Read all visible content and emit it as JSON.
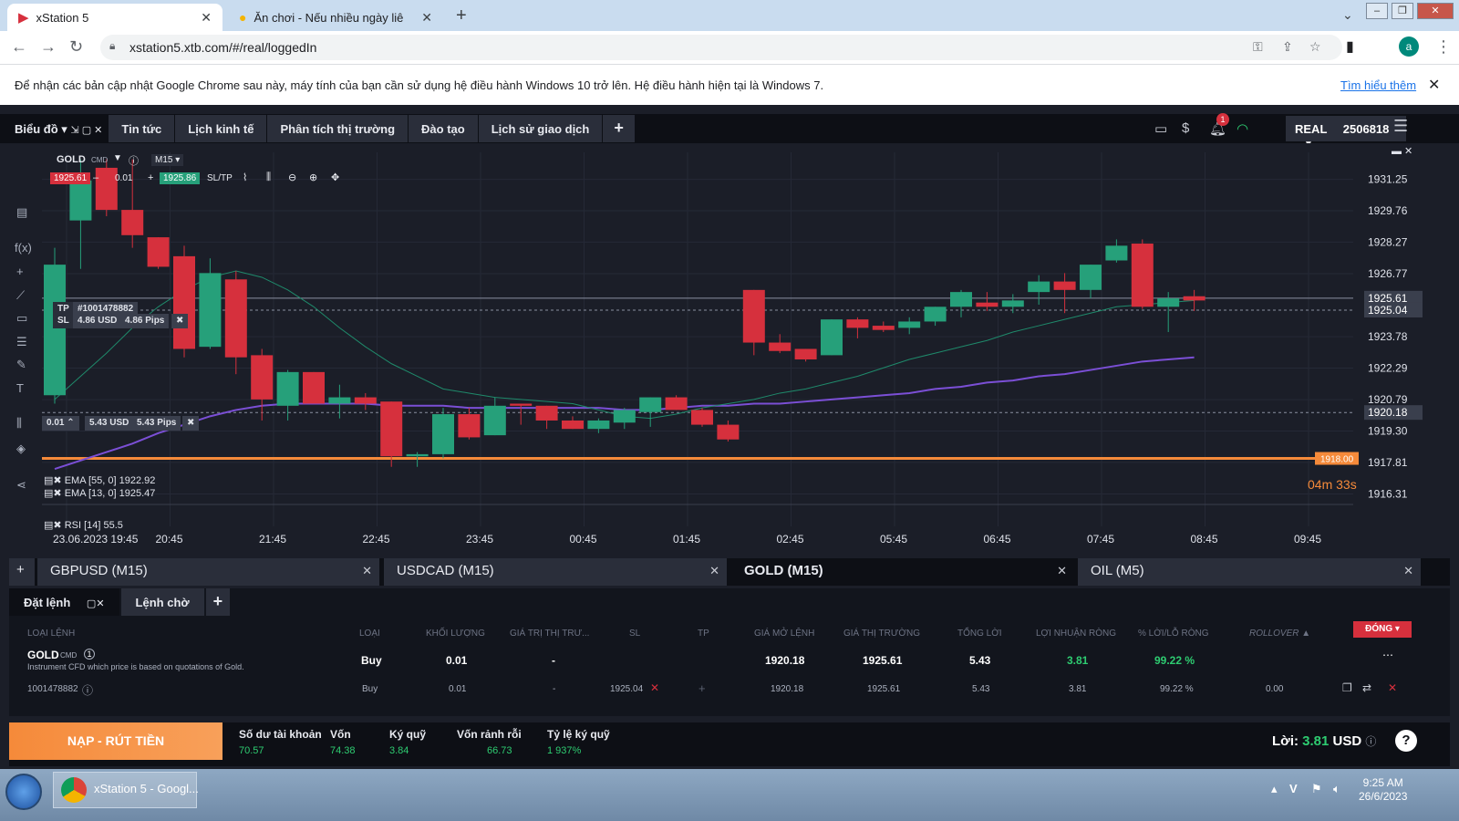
{
  "browser": {
    "tabs": [
      {
        "title": "xStation 5"
      },
      {
        "title": "Ăn chơi - Nếu nhiều ngày liên ch"
      }
    ],
    "url": "xstation5.xtb.com/#/real/loggedIn",
    "avatar_letter": "a",
    "infobar": {
      "text": "Để nhận các bản cập nhật Google Chrome sau này, máy tính của bạn cần sử dụng hệ điều hành Windows 10 trở lên. Hệ điều hành hiện tại là Windows 7.",
      "link": "Tìm hiểu thêm"
    }
  },
  "app": {
    "nav": [
      {
        "label": "Biểu đồ"
      },
      {
        "label": "Tin tức"
      },
      {
        "label": "Lịch kinh tế"
      },
      {
        "label": "Phân tích thị trường"
      },
      {
        "label": "Đào tạo"
      },
      {
        "label": "Lịch sử giao dịch"
      }
    ],
    "notifications": "1",
    "account_type": "REAL",
    "account_number": "2506818"
  },
  "chart": {
    "symbol": "GOLD",
    "badge": "CMD",
    "timeframe": "M15",
    "sell_price": "1925.61",
    "volume": "0.01",
    "buy_price": "1925.86",
    "sltp_label": "SL/TP",
    "tp_label": "TP",
    "order_id": "#1001478882",
    "sl_label": "SL",
    "sl_usd": "4.86 USD",
    "sl_pips": "4.86 Pips",
    "pos_volume": "0.01",
    "pos_usd": "5.43 USD",
    "pos_pips": "5.43 Pips",
    "ema55": "EMA [55, 0] 1922.92",
    "ema13": "EMA [13, 0] 1925.47",
    "rsi": "RSI [14] 55.5",
    "countdown": "04m 33s",
    "alert_level": "1918.00",
    "price_labels": [
      "1931.25",
      "1929.76",
      "1928.27",
      "1926.77",
      "1925.61",
      "1925.04",
      "1923.78",
      "1922.29",
      "1920.79",
      "1920.18",
      "1919.30",
      "1917.81",
      "1916.31"
    ],
    "time_labels": [
      "23.06.2023 19:45",
      "20:45",
      "21:45",
      "22:45",
      "23:45",
      "00:45",
      "01:45",
      "02:45",
      "05:45",
      "06:45",
      "07:45",
      "08:45",
      "09:45"
    ]
  },
  "chart_data": {
    "type": "candlestick",
    "ylim": [
      1915.9,
      1932.1
    ],
    "candles": [
      {
        "o": 1921.0,
        "h": 1928.0,
        "l": 1920.6,
        "c": 1927.2
      },
      {
        "o": 1929.3,
        "h": 1932.2,
        "l": 1927.0,
        "c": 1931.2
      },
      {
        "o": 1931.8,
        "h": 1932.2,
        "l": 1929.5,
        "c": 1929.8
      },
      {
        "o": 1929.8,
        "h": 1932.2,
        "l": 1928.0,
        "c": 1928.6
      },
      {
        "o": 1928.5,
        "h": 1928.5,
        "l": 1927.0,
        "c": 1927.1
      },
      {
        "o": 1927.6,
        "h": 1928.1,
        "l": 1922.8,
        "c": 1923.2
      },
      {
        "o": 1923.3,
        "h": 1927.5,
        "l": 1923.2,
        "c": 1926.8
      },
      {
        "o": 1926.5,
        "h": 1926.9,
        "l": 1922.0,
        "c": 1922.8
      },
      {
        "o": 1922.9,
        "h": 1923.2,
        "l": 1919.8,
        "c": 1920.8
      },
      {
        "o": 1920.5,
        "h": 1922.2,
        "l": 1919.8,
        "c": 1922.1
      },
      {
        "o": 1922.1,
        "h": 1922.1,
        "l": 1920.6,
        "c": 1920.6
      },
      {
        "o": 1920.6,
        "h": 1921.5,
        "l": 1919.9,
        "c": 1920.9
      },
      {
        "o": 1920.9,
        "h": 1921.1,
        "l": 1920.3,
        "c": 1920.6
      },
      {
        "o": 1920.7,
        "h": 1920.7,
        "l": 1917.6,
        "c": 1918.1
      },
      {
        "o": 1918.1,
        "h": 1918.3,
        "l": 1917.6,
        "c": 1918.2
      },
      {
        "o": 1918.2,
        "h": 1920.4,
        "l": 1918.0,
        "c": 1920.1
      },
      {
        "o": 1920.1,
        "h": 1920.4,
        "l": 1918.9,
        "c": 1919.0
      },
      {
        "o": 1919.1,
        "h": 1920.9,
        "l": 1919.1,
        "c": 1920.5
      },
      {
        "o": 1920.6,
        "h": 1920.6,
        "l": 1919.6,
        "c": 1920.5
      },
      {
        "o": 1920.5,
        "h": 1920.5,
        "l": 1919.4,
        "c": 1919.8
      },
      {
        "o": 1919.8,
        "h": 1920.0,
        "l": 1919.4,
        "c": 1919.4
      },
      {
        "o": 1919.4,
        "h": 1919.9,
        "l": 1919.2,
        "c": 1919.8
      },
      {
        "o": 1919.7,
        "h": 1920.4,
        "l": 1919.4,
        "c": 1920.3
      },
      {
        "o": 1920.2,
        "h": 1920.9,
        "l": 1919.5,
        "c": 1920.9
      },
      {
        "o": 1920.9,
        "h": 1921.0,
        "l": 1920.3,
        "c": 1920.3
      },
      {
        "o": 1920.3,
        "h": 1920.4,
        "l": 1919.5,
        "c": 1919.6
      },
      {
        "o": 1919.6,
        "h": 1919.8,
        "l": 1918.8,
        "c": 1918.9
      },
      {
        "o": 1926.0,
        "h": 1926.0,
        "l": 1922.9,
        "c": 1923.5
      },
      {
        "o": 1923.5,
        "h": 1923.9,
        "l": 1923.0,
        "c": 1923.1
      },
      {
        "o": 1923.2,
        "h": 1923.2,
        "l": 1922.6,
        "c": 1922.7
      },
      {
        "o": 1922.9,
        "h": 1924.6,
        "l": 1922.9,
        "c": 1924.6
      },
      {
        "o": 1924.6,
        "h": 1924.7,
        "l": 1923.7,
        "c": 1924.2
      },
      {
        "o": 1924.3,
        "h": 1924.5,
        "l": 1924.0,
        "c": 1924.1
      },
      {
        "o": 1924.2,
        "h": 1924.7,
        "l": 1923.9,
        "c": 1924.5
      },
      {
        "o": 1924.5,
        "h": 1925.2,
        "l": 1924.3,
        "c": 1925.2
      },
      {
        "o": 1925.2,
        "h": 1926.0,
        "l": 1924.7,
        "c": 1925.9
      },
      {
        "o": 1925.4,
        "h": 1925.9,
        "l": 1925.0,
        "c": 1925.2
      },
      {
        "o": 1925.2,
        "h": 1925.8,
        "l": 1924.9,
        "c": 1925.5
      },
      {
        "o": 1925.9,
        "h": 1926.7,
        "l": 1925.3,
        "c": 1926.4
      },
      {
        "o": 1926.4,
        "h": 1926.8,
        "l": 1924.9,
        "c": 1926.0
      },
      {
        "o": 1926.0,
        "h": 1927.2,
        "l": 1925.6,
        "c": 1927.2
      },
      {
        "o": 1927.4,
        "h": 1928.4,
        "l": 1927.3,
        "c": 1928.1
      },
      {
        "o": 1928.2,
        "h": 1928.4,
        "l": 1925.1,
        "c": 1925.2
      },
      {
        "o": 1925.2,
        "h": 1925.9,
        "l": 1924.0,
        "c": 1925.6
      },
      {
        "o": 1925.7,
        "h": 1926.0,
        "l": 1925.0,
        "c": 1925.5
      }
    ],
    "ema13": [
      1920.8,
      1921.9,
      1923.0,
      1924.2,
      1925.2,
      1926.0,
      1926.6,
      1926.9,
      1926.6,
      1926.0,
      1925.2,
      1924.2,
      1923.3,
      1922.5,
      1921.9,
      1921.3,
      1921.1,
      1920.9,
      1920.8,
      1920.7,
      1920.6,
      1920.3,
      1920.0,
      1919.9,
      1920.1,
      1920.4,
      1920.6,
      1920.8,
      1921.1,
      1921.3,
      1921.6,
      1921.9,
      1922.3,
      1922.7,
      1923.0,
      1923.3,
      1923.6,
      1924.0,
      1924.3,
      1924.6,
      1924.9,
      1925.2,
      1925.3,
      1925.4,
      1925.5
    ],
    "ema55": [
      1917.5,
      1917.9,
      1918.3,
      1918.7,
      1919.2,
      1919.6,
      1920.0,
      1920.3,
      1920.5,
      1920.6,
      1920.6,
      1920.6,
      1920.6,
      1920.5,
      1920.5,
      1920.5,
      1920.4,
      1920.4,
      1920.4,
      1920.4,
      1920.4,
      1920.4,
      1920.3,
      1920.3,
      1920.4,
      1920.5,
      1920.5,
      1920.6,
      1920.6,
      1920.7,
      1920.8,
      1920.9,
      1921.0,
      1921.1,
      1921.3,
      1921.4,
      1921.6,
      1921.7,
      1921.9,
      1922.0,
      1922.2,
      1922.4,
      1922.6,
      1922.7,
      1922.8
    ],
    "levels": {
      "tp": 1925.61,
      "sl": 1925.04,
      "open": 1920.18,
      "alert": 1918.0
    }
  },
  "symbol_tabs": [
    {
      "label": "GBPUSD (M15)"
    },
    {
      "label": "USDCAD (M15)"
    },
    {
      "label": "GOLD (M15)"
    },
    {
      "label": "OIL (M5)"
    }
  ],
  "trade": {
    "tabs": [
      {
        "label": "Đặt lệnh"
      },
      {
        "label": "Lệnh chờ"
      }
    ],
    "headers": [
      "LOẠI LỆNH",
      "LOẠI",
      "KHỐI LƯỢNG",
      "GIÁ TRỊ THỊ TRƯ...",
      "SL",
      "TP",
      "GIÁ MỞ LỆNH",
      "GIÁ THỊ TRƯỜNG",
      "TỔNG LỜI",
      "LỢI NHUẬN RÒNG",
      "% LỜI/LỖ RÒNG",
      "ROLLOVER ▲"
    ],
    "close_label": "ĐÓNG",
    "summary": {
      "symbol": "GOLD",
      "badge": "CMD",
      "count": "1",
      "description": "Instrument CFD which price is based on quotations of Gold.",
      "type": "Buy",
      "volume": "0.01",
      "market_value": "-",
      "open_price": "1920.18",
      "market_price": "1925.61",
      "gross": "5.43",
      "net": "3.81",
      "pct": "99.22 %"
    },
    "row": {
      "id": "1001478882",
      "type": "Buy",
      "volume": "0.01",
      "market_value": "-",
      "sl": "1925.04",
      "open_price": "1920.18",
      "market_price": "1925.61",
      "gross": "5.43",
      "net": "3.81",
      "pct": "99.22 %",
      "rollover": "0.00"
    }
  },
  "footer": {
    "deposit_label": "NẠP - RÚT TIỀN",
    "stats": [
      {
        "label": "Số dư tài khoản",
        "value": "70.57"
      },
      {
        "label": "Vốn",
        "value": "74.38"
      },
      {
        "label": "Ký quỹ",
        "value": "3.84"
      },
      {
        "label": "Vốn rảnh rỗi",
        "value": "66.73"
      },
      {
        "label": "Tỷ lệ ký quỹ",
        "value": "1 937%"
      }
    ],
    "profit_label": "Lời:",
    "profit_value": "3.81",
    "profit_currency": "USD"
  },
  "taskbar": {
    "app_label": "xStation 5 - Googl...",
    "time": "9:25 AM",
    "date": "26/6/2023"
  }
}
